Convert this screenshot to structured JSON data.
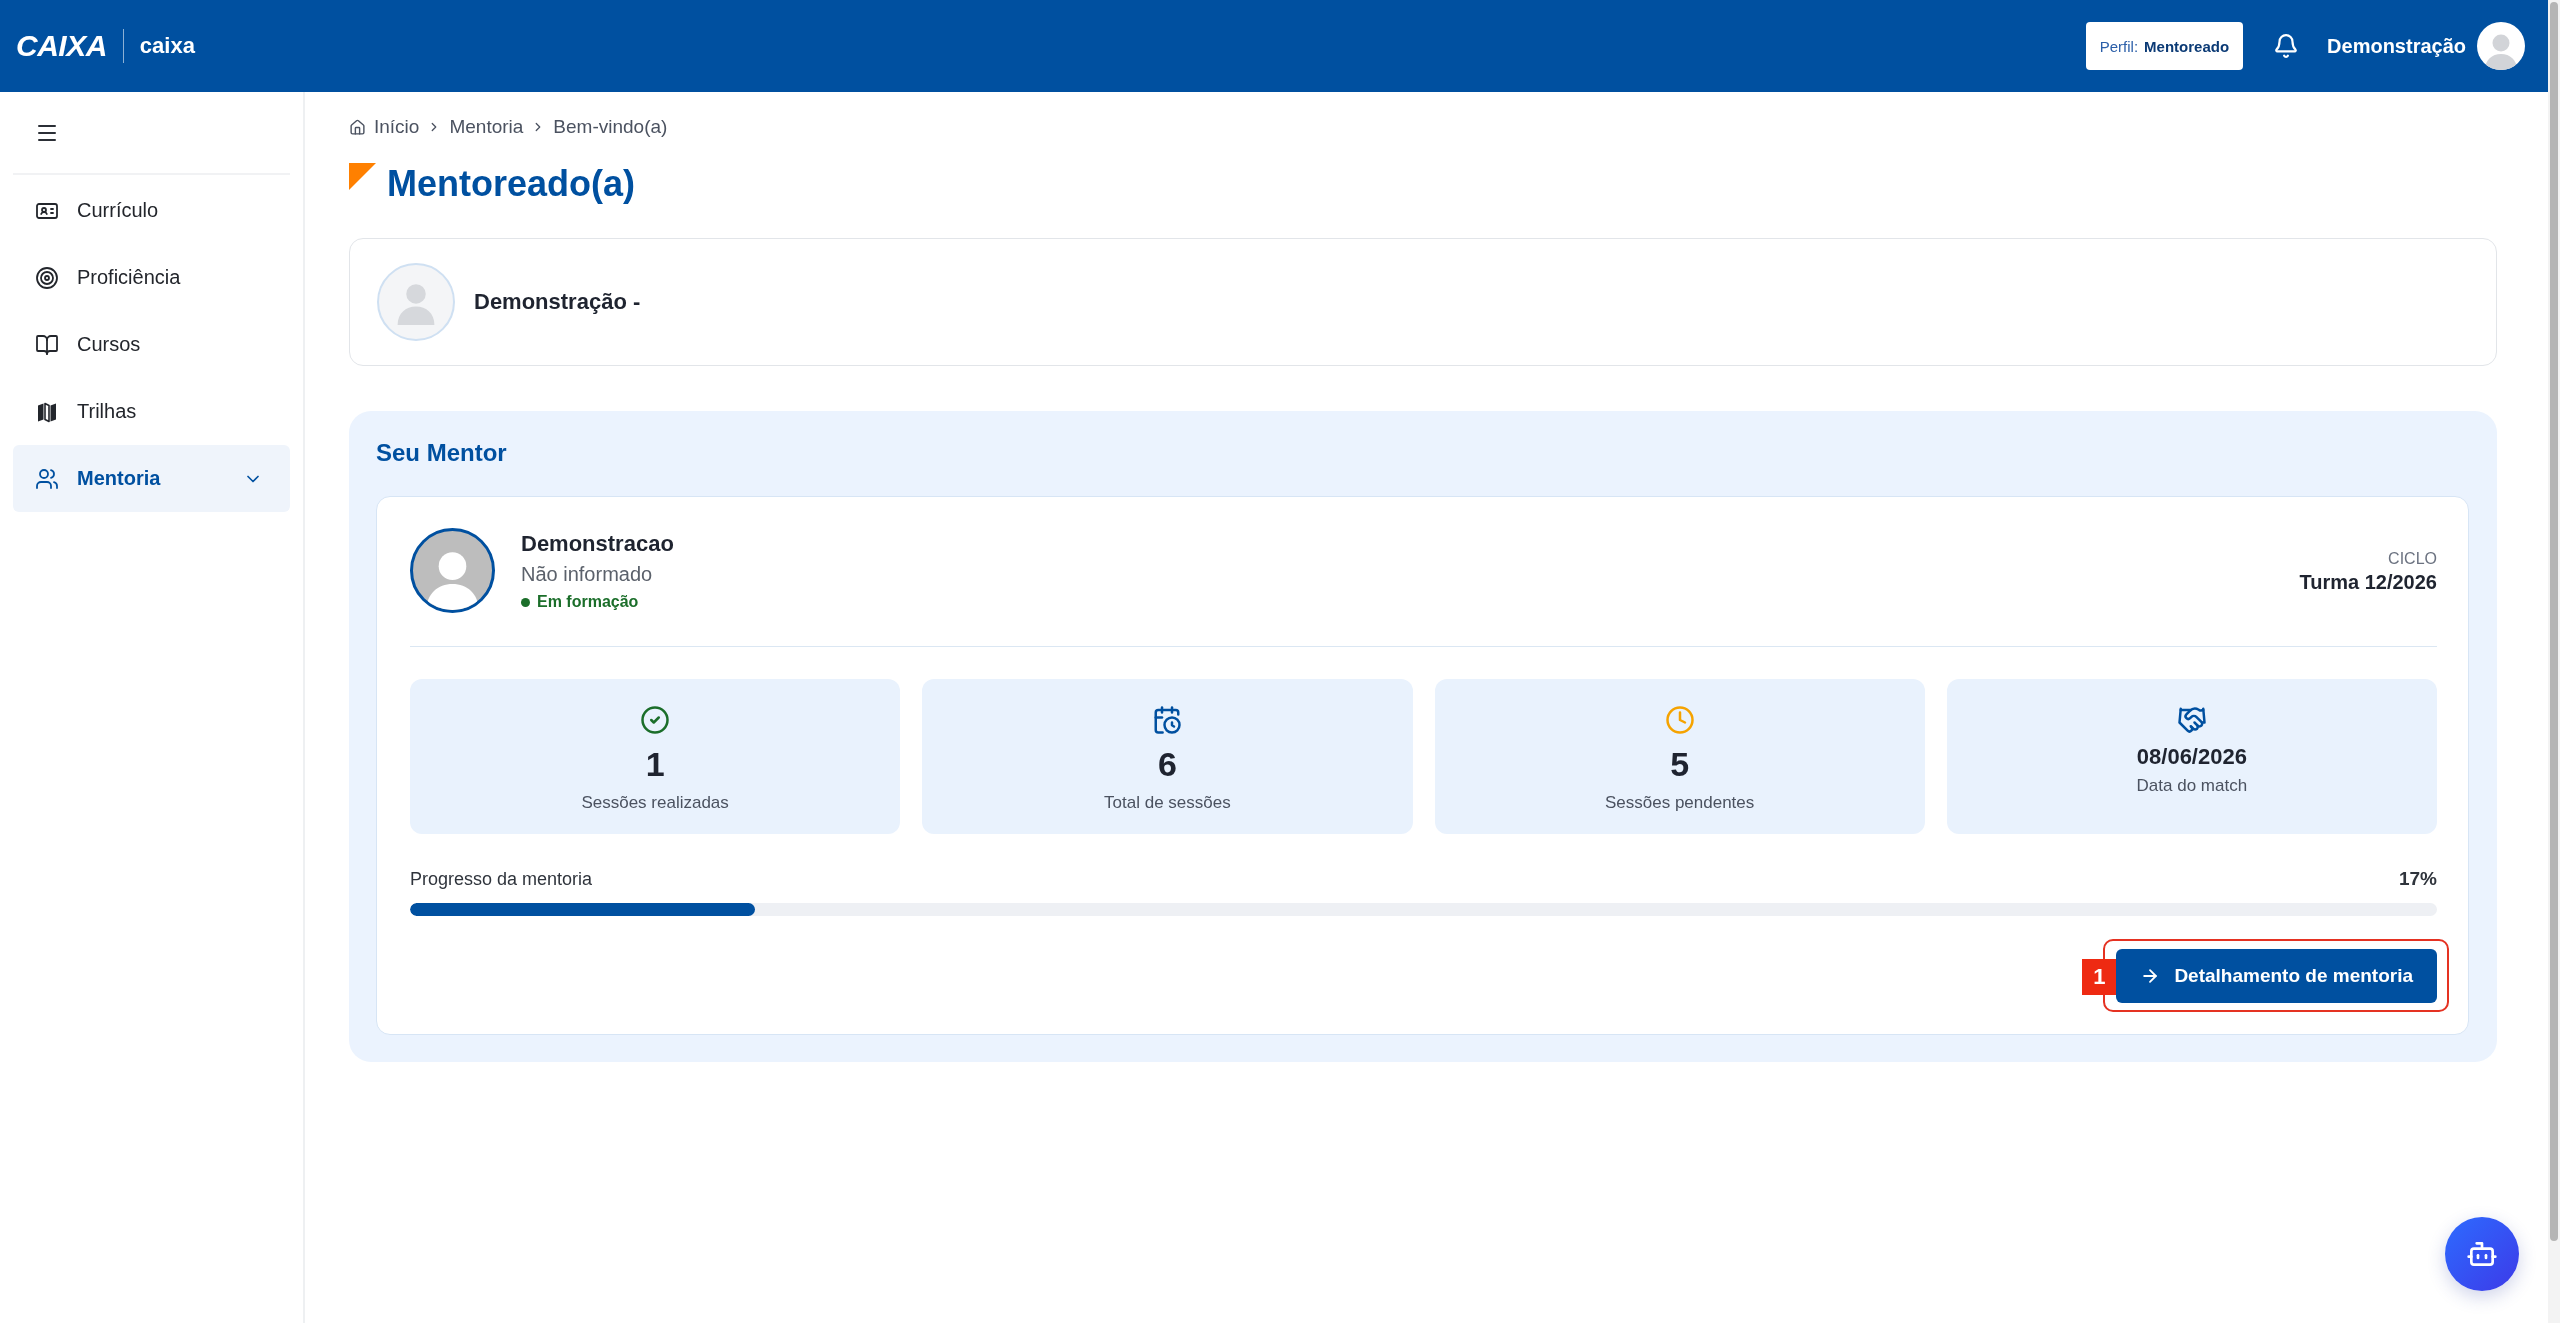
{
  "header": {
    "brand": "CAIXA",
    "app_name": "caixa",
    "profile": {
      "label": "Perfil:",
      "value": "Mentoreado"
    },
    "user_name": "Demonstração"
  },
  "sidebar": {
    "items": [
      {
        "kind": "resume",
        "label": "Currículo",
        "selected": false
      },
      {
        "kind": "target",
        "label": "Proficiência",
        "selected": false
      },
      {
        "kind": "book",
        "label": "Cursos",
        "selected": false
      },
      {
        "kind": "map",
        "label": "Trilhas",
        "selected": false
      },
      {
        "kind": "people",
        "label": "Mentoria",
        "selected": true,
        "expanded": false
      }
    ]
  },
  "breadcrumb": [
    "Início",
    "Mentoria",
    "Bem-vindo(a)"
  ],
  "page_title": "Mentoreado(a)",
  "profile_card": {
    "name": "Demonstração -"
  },
  "mentor_section": {
    "title": "Seu Mentor",
    "mentor": {
      "name": "Demonstracao",
      "role": "Não informado",
      "status": "Em formação"
    },
    "cycle": {
      "label": "CICLO",
      "value": "Turma 12/2026"
    },
    "stats": [
      {
        "kind": "done",
        "value": "1",
        "label": "Sessões realizadas"
      },
      {
        "kind": "total",
        "value": "6",
        "label": "Total de sessões"
      },
      {
        "kind": "pending",
        "value": "5",
        "label": "Sessões pendentes"
      },
      {
        "kind": "match",
        "value": "08/06/2026",
        "label": "Data do match"
      }
    ],
    "progress": {
      "label": "Progresso da mentoria",
      "reading": "17%",
      "level": 0.17
    },
    "action_button": {
      "label": "Detalhamento de mentoria",
      "annotation": "1"
    }
  }
}
